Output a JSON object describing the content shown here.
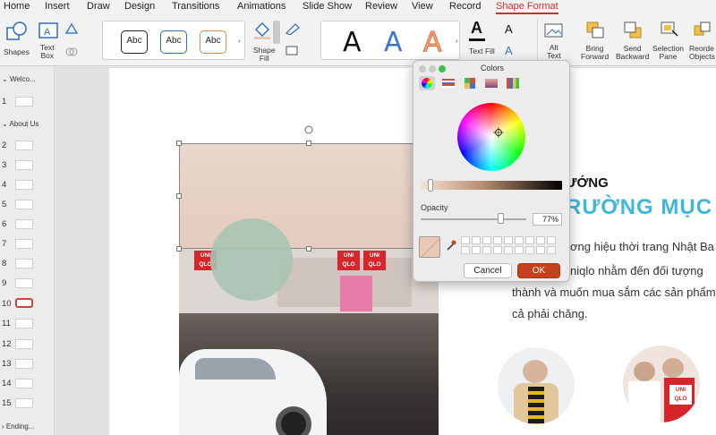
{
  "menu": {
    "tabs": [
      "Home",
      "Insert",
      "Draw",
      "Design",
      "Transitions",
      "Animations",
      "Slide Show",
      "Review",
      "View",
      "Record",
      "Shape Format"
    ],
    "active_tab": "Shape Format"
  },
  "ribbon": {
    "shapes_label": "Shapes",
    "text_box_label": "Text\nBox",
    "abc_label": "Abc",
    "shape_fill_label": "Shape\nFill",
    "text_fill_label": "Text Fill",
    "wordart_letter": "A",
    "alt_text_label": "Alt\nText",
    "bring_forward_label": "Bring\nForward",
    "send_backward_label": "Send\nBackward",
    "selection_pane_label": "Selection\nPane",
    "reorder_objects_label": "Reorde\nObjects",
    "accent": "#c4362c"
  },
  "sidebar": {
    "sections": [
      {
        "label": "Welco...",
        "slides": [
          "1"
        ]
      },
      {
        "label": "About Us",
        "slides": [
          "2",
          "3",
          "4",
          "5",
          "6",
          "7",
          "8",
          "9",
          "10",
          "11",
          "12",
          "13",
          "14",
          "15"
        ]
      },
      {
        "label": "Ending...",
        "slides": []
      }
    ],
    "selected_slide": "10"
  },
  "slide": {
    "heading_partial": "ƯỚNG",
    "subheading_partial": "RƯỜNG MỤC T",
    "body_lines": [
      "ơng hiệu thời trang Nhật Ba",
      "niqlo nhằm đến đối tượng",
      "thành và muốn mua sắm các sản phẩm",
      "cả phải chăng."
    ],
    "store_sign": "UNI\nQLO",
    "heading_accent": "#41b6dc"
  },
  "colors_dialog": {
    "title": "Colors",
    "opacity_label": "Opacity",
    "opacity_value": "77%",
    "opacity_fraction": 0.77,
    "current_color": "#e9c9b5",
    "cancel_label": "Cancel",
    "ok_label": "OK",
    "ok_color": "#c5401c"
  }
}
